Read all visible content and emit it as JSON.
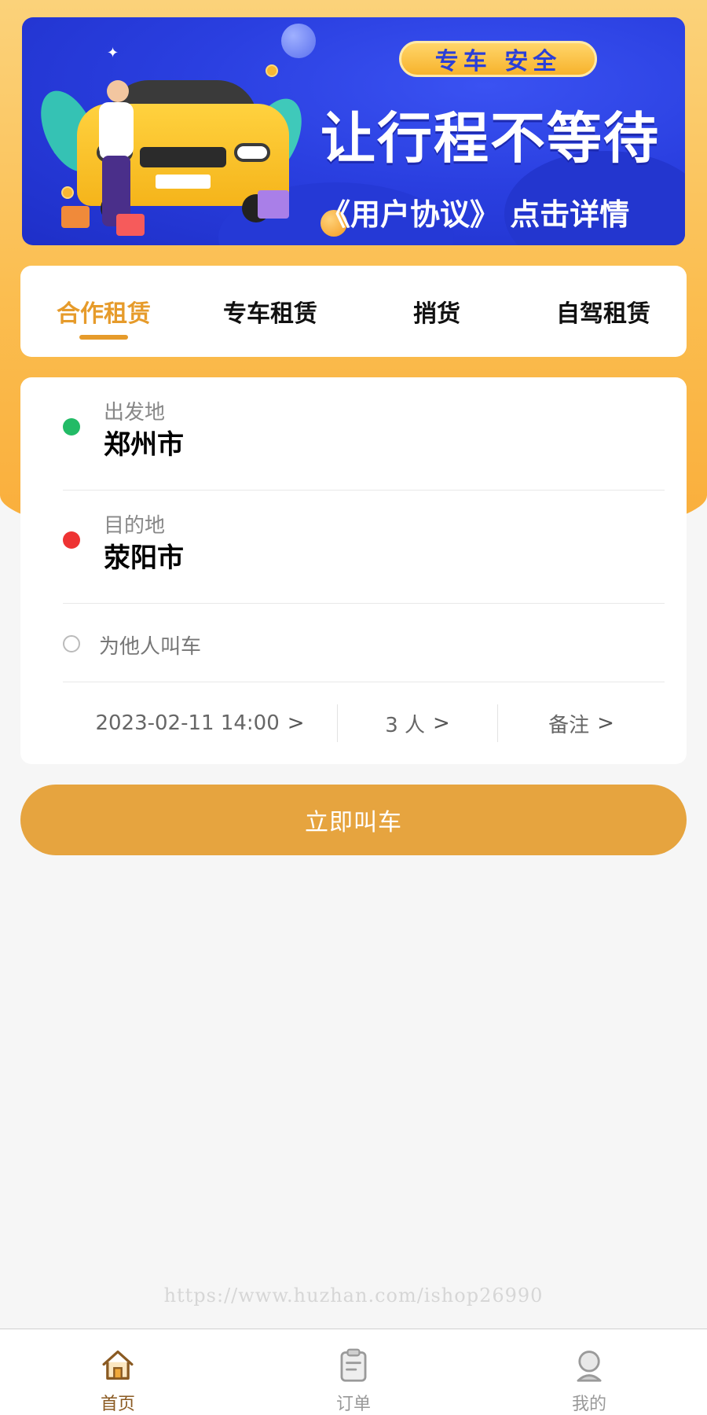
{
  "banner": {
    "badge": "专车 安全",
    "title": "让行程不等待",
    "subtitle": "《用户协议》 点击详情"
  },
  "tabs": [
    {
      "label": "合作租赁",
      "active": true
    },
    {
      "label": "专车租赁",
      "active": false
    },
    {
      "label": "捎货",
      "active": false
    },
    {
      "label": "自驾租赁",
      "active": false
    }
  ],
  "form": {
    "origin": {
      "label": "出发地",
      "city": "郑州市",
      "dot_color": "#22bb66"
    },
    "destination": {
      "label": "目的地",
      "city": "荥阳市",
      "dot_color": "#ee3333"
    },
    "call_for_others": "为他人叫车",
    "datetime": "2023-02-11 14:00",
    "passengers": "3 人",
    "remark": "备注"
  },
  "call_button": "立即叫车",
  "watermark": "https://www.huzhan.com/ishop26990",
  "bottom_nav": [
    {
      "label": "首页",
      "icon": "home-icon",
      "active": true
    },
    {
      "label": "订单",
      "icon": "clipboard-icon",
      "active": false
    },
    {
      "label": "我的",
      "icon": "user-icon",
      "active": false
    }
  ],
  "colors": {
    "accent": "#e69b2b",
    "button": "#e6a43f",
    "banner_blue": "#2a3fe0"
  }
}
